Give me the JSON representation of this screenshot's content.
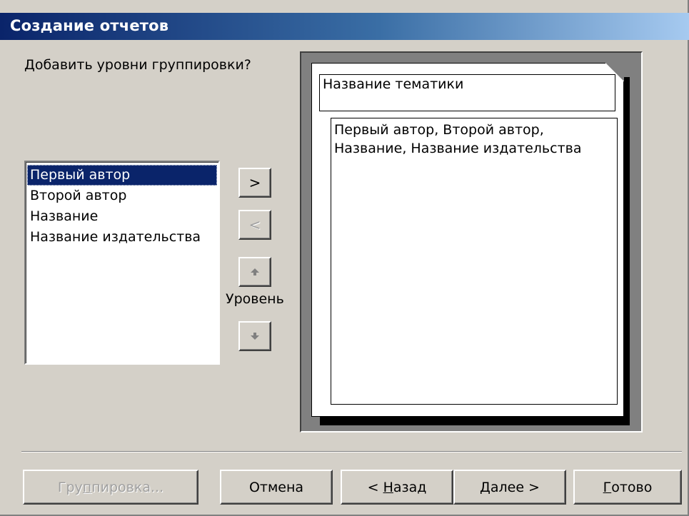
{
  "window": {
    "title": "Создание отчетов"
  },
  "prompt": "Добавить уровни группировки?",
  "fields": [
    {
      "label": "Первый автор",
      "selected": true
    },
    {
      "label": "Второй автор",
      "selected": false
    },
    {
      "label": "Название",
      "selected": false
    },
    {
      "label": "Название издательства",
      "selected": false
    }
  ],
  "controls": {
    "add_label": ">",
    "remove_label": "<",
    "level_label": "Уровень",
    "up_icon": "arrow-up-icon",
    "down_icon": "arrow-down-icon"
  },
  "preview": {
    "group_header": "Название тематики",
    "detail_line1": "Первый автор, Второй автор,",
    "detail_line2": "Название, Название издательства"
  },
  "buttons": {
    "grouping": {
      "pre": "Гру",
      "accel": "п",
      "post": "пировка...",
      "enabled": false
    },
    "cancel": {
      "label": "Отмена"
    },
    "back": {
      "pre": "< ",
      "accel": "Н",
      "post": "азад"
    },
    "next": {
      "pre": "",
      "accel": "Д",
      "post": "алее >"
    },
    "finish": {
      "pre": "",
      "accel": "Г",
      "post": "отово"
    }
  }
}
